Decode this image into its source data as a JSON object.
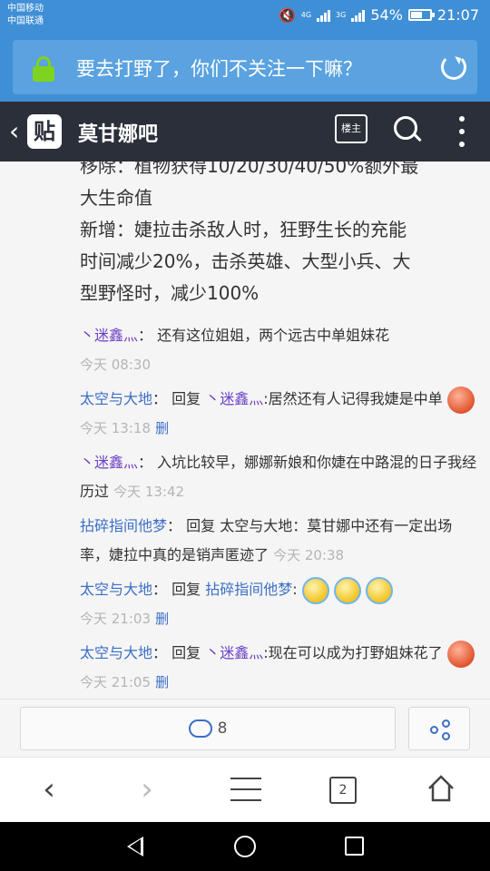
{
  "status_bar": {
    "carrier_1": "中国移动",
    "carrier_2": "中国联通",
    "net_1": "4G",
    "net_2": "3G",
    "battery": "54%",
    "time": "21:07"
  },
  "url_bar": {
    "title": "要去打野了，你们不关注一下嘛？",
    "icons": [
      "lock-icon",
      "refresh-icon"
    ]
  },
  "header": {
    "logo_text": "贴",
    "forum_name": "莫甘娜吧",
    "louzhu_label": "楼主"
  },
  "post_body": {
    "line_0": "移除：植物获得10/20/30/40/50%额外最",
    "line_1": "大生命值",
    "line_2": "新增：婕拉击杀敌人时，狂野生长的充能",
    "line_3": "时间减少20%，击杀英雄、大型小兵、大",
    "line_4": "型野怪时，减少100%"
  },
  "replies": [
    {
      "user": "丶迷鑫灬",
      "sep": "：",
      "text": "还有这位姐姐，两个远古中单姐妹花",
      "time": "今天 08:30"
    },
    {
      "user": "太空与大地",
      "sep": "：",
      "reply_label": "回复",
      "reply_to": "丶迷鑫灬",
      "text": ":居然还有人记得我婕是中单",
      "time": "今天 13:18",
      "delete": "删"
    },
    {
      "user": "丶迷鑫灬",
      "sep": "：",
      "text": "入坑比较早，娜娜新娘和你婕在中路混的日子我经历过",
      "time": "今天 13:42"
    },
    {
      "user": "拈碎指间他梦",
      "sep": "：",
      "reply_label": "回复",
      "reply_to": "太空与大地",
      "text": "：莫甘娜中还有一定出场率，婕拉中真的是销声匿迹了",
      "time": "今天 20:38"
    },
    {
      "user": "太空与大地",
      "sep": "：",
      "reply_label": "回复",
      "reply_to": "拈碎指间他梦",
      "text": ":",
      "time": "今天 21:03",
      "delete": "删"
    },
    {
      "user": "太空与大地",
      "sep": "：",
      "reply_label": "回复",
      "reply_to": "丶迷鑫灬",
      "text": ":现在可以成为打野姐妹花了",
      "time": "今天 21:05",
      "delete": "删"
    }
  ],
  "action_bar": {
    "comment_count": "8",
    "icons": [
      "comment-icon",
      "share-icon"
    ]
  },
  "browser_nav": {
    "tab_count": "2"
  },
  "colors": {
    "statusbar": "#3f8fd6",
    "header": "#2b2f3a",
    "link": "#3c6fc6",
    "lock": "#7ed321"
  }
}
